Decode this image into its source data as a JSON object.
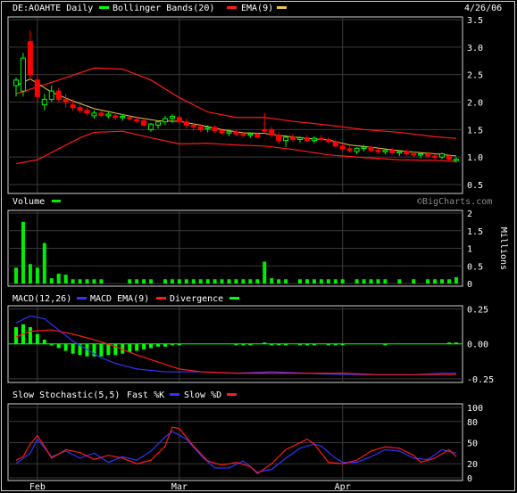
{
  "colors": {
    "background": "#000000",
    "frame": "#d0d0d0",
    "grid": "#3a3a3a",
    "text": "#ffffff",
    "up_candle": "#00ff00",
    "down_candle": "#ff0000",
    "bollinger": "#ff1a1a",
    "ema": "#e6c84a",
    "volume": "#00ee00",
    "macd": "#3333ff",
    "macd_ema": "#ff1a1a",
    "divergence": "#00ff00",
    "fast_k": "#3333ff",
    "slow_d": "#ff1a1a",
    "watermark": "#8a8a8a"
  },
  "chart_data": [
    {
      "type": "candlestick",
      "title": "DE:AOAHTE Daily",
      "date": "4/26/06",
      "legend": [
        {
          "name": "Bollinger Bands(20)",
          "color": "#00ff00"
        },
        {
          "name": "EMA(9)",
          "color": "#e6c84a"
        }
      ],
      "yticks": [
        "3.5",
        "3.0",
        "2.5",
        "2.0",
        "1.5",
        "1.0",
        "0.5"
      ],
      "ylim": [
        0.5,
        3.5
      ],
      "candles": [
        [
          2.4,
          2.45,
          2.1,
          2.3,
          "up"
        ],
        [
          2.2,
          2.9,
          2.1,
          2.8,
          "up"
        ],
        [
          3.1,
          3.3,
          2.4,
          2.5,
          "down"
        ],
        [
          2.4,
          2.5,
          2.0,
          2.1,
          "down"
        ],
        [
          1.95,
          2.15,
          1.85,
          2.05,
          "up"
        ],
        [
          2.05,
          2.3,
          2.0,
          2.2,
          "up"
        ],
        [
          2.2,
          2.25,
          2.0,
          2.05,
          "down"
        ],
        [
          2.05,
          2.15,
          1.9,
          2.0,
          "down"
        ],
        [
          1.95,
          2.05,
          1.85,
          1.9,
          "down"
        ],
        [
          1.9,
          1.95,
          1.8,
          1.85,
          "down"
        ],
        [
          1.85,
          1.9,
          1.75,
          1.8,
          "down"
        ],
        [
          1.75,
          1.85,
          1.7,
          1.8,
          "up"
        ],
        [
          1.8,
          1.85,
          1.72,
          1.76,
          "down"
        ],
        [
          1.75,
          1.82,
          1.7,
          1.78,
          "up"
        ],
        [
          1.75,
          1.8,
          1.68,
          1.72,
          "down"
        ],
        [
          1.72,
          1.78,
          1.66,
          1.74,
          "up"
        ],
        [
          1.72,
          1.76,
          1.66,
          1.7,
          "down"
        ],
        [
          1.68,
          1.74,
          1.62,
          1.66,
          "down"
        ],
        [
          1.66,
          1.7,
          1.55,
          1.58,
          "down"
        ],
        [
          1.5,
          1.62,
          1.46,
          1.6,
          "up"
        ],
        [
          1.58,
          1.66,
          1.52,
          1.64,
          "up"
        ],
        [
          1.64,
          1.75,
          1.58,
          1.7,
          "up"
        ],
        [
          1.7,
          1.78,
          1.62,
          1.74,
          "up"
        ],
        [
          1.72,
          1.76,
          1.6,
          1.64,
          "down"
        ],
        [
          1.64,
          1.7,
          1.52,
          1.58,
          "down"
        ],
        [
          1.58,
          1.62,
          1.48,
          1.55,
          "down"
        ],
        [
          1.55,
          1.6,
          1.46,
          1.5,
          "down"
        ],
        [
          1.52,
          1.58,
          1.45,
          1.54,
          "up"
        ],
        [
          1.54,
          1.58,
          1.44,
          1.48,
          "down"
        ],
        [
          1.48,
          1.52,
          1.4,
          1.44,
          "down"
        ],
        [
          1.44,
          1.5,
          1.38,
          1.46,
          "up"
        ],
        [
          1.46,
          1.5,
          1.38,
          1.42,
          "down"
        ],
        [
          1.42,
          1.46,
          1.36,
          1.4,
          "down"
        ],
        [
          1.4,
          1.45,
          1.35,
          1.42,
          "up"
        ],
        [
          1.42,
          1.45,
          1.34,
          1.36,
          "down"
        ],
        [
          1.48,
          1.8,
          1.42,
          1.5,
          "down"
        ],
        [
          1.5,
          1.55,
          1.35,
          1.4,
          "down"
        ],
        [
          1.4,
          1.45,
          1.25,
          1.3,
          "down"
        ],
        [
          1.3,
          1.4,
          1.18,
          1.36,
          "up"
        ],
        [
          1.36,
          1.42,
          1.28,
          1.32,
          "down"
        ],
        [
          1.32,
          1.38,
          1.26,
          1.35,
          "up"
        ],
        [
          1.35,
          1.4,
          1.28,
          1.3,
          "down"
        ],
        [
          1.3,
          1.38,
          1.25,
          1.34,
          "up"
        ],
        [
          1.34,
          1.4,
          1.28,
          1.32,
          "down"
        ],
        [
          1.32,
          1.36,
          1.25,
          1.28,
          "down"
        ],
        [
          1.28,
          1.32,
          1.18,
          1.2,
          "down"
        ],
        [
          1.2,
          1.25,
          1.12,
          1.15,
          "down"
        ],
        [
          1.15,
          1.2,
          1.08,
          1.12,
          "down"
        ],
        [
          1.1,
          1.18,
          1.06,
          1.16,
          "up"
        ],
        [
          1.16,
          1.22,
          1.1,
          1.18,
          "up"
        ],
        [
          1.18,
          1.2,
          1.1,
          1.12,
          "down"
        ],
        [
          1.12,
          1.16,
          1.05,
          1.1,
          "down"
        ],
        [
          1.1,
          1.15,
          1.05,
          1.12,
          "up"
        ],
        [
          1.12,
          1.16,
          1.06,
          1.08,
          "down"
        ],
        [
          1.08,
          1.12,
          1.02,
          1.1,
          "up"
        ],
        [
          1.1,
          1.14,
          1.03,
          1.06,
          "down"
        ],
        [
          1.06,
          1.1,
          1.0,
          1.04,
          "down"
        ],
        [
          1.04,
          1.08,
          0.98,
          1.06,
          "up"
        ],
        [
          1.06,
          1.1,
          0.98,
          1.02,
          "down"
        ],
        [
          1.02,
          1.06,
          0.96,
          1.0,
          "down"
        ],
        [
          1.0,
          1.08,
          0.96,
          1.06,
          "up"
        ],
        [
          1.02,
          1.05,
          0.94,
          0.96,
          "down"
        ],
        [
          0.96,
          1.0,
          0.9,
          0.94,
          "up"
        ]
      ],
      "bollinger_upper": [
        [
          0,
          2.15
        ],
        [
          6,
          2.4
        ],
        [
          11,
          2.62
        ],
        [
          15,
          2.6
        ],
        [
          19,
          2.4
        ],
        [
          23,
          2.08
        ],
        [
          27,
          1.82
        ],
        [
          31,
          1.72
        ],
        [
          35,
          1.72
        ],
        [
          39,
          1.65
        ],
        [
          44,
          1.58
        ],
        [
          49,
          1.5
        ],
        [
          54,
          1.45
        ],
        [
          59,
          1.37
        ],
        [
          62,
          1.34
        ]
      ],
      "bollinger_lower": [
        [
          0,
          0.88
        ],
        [
          3,
          0.95
        ],
        [
          6,
          1.15
        ],
        [
          9,
          1.35
        ],
        [
          11,
          1.45
        ],
        [
          15,
          1.47
        ],
        [
          19,
          1.35
        ],
        [
          23,
          1.24
        ],
        [
          27,
          1.25
        ],
        [
          31,
          1.22
        ],
        [
          35,
          1.2
        ],
        [
          39,
          1.14
        ],
        [
          44,
          1.04
        ],
        [
          49,
          0.99
        ],
        [
          54,
          0.95
        ],
        [
          59,
          0.94
        ],
        [
          62,
          0.92
        ]
      ],
      "ema": [
        [
          0,
          2.3
        ],
        [
          2,
          2.42
        ],
        [
          5,
          2.18
        ],
        [
          8,
          2.02
        ],
        [
          11,
          1.88
        ],
        [
          14,
          1.8
        ],
        [
          17,
          1.72
        ],
        [
          20,
          1.66
        ],
        [
          23,
          1.65
        ],
        [
          26,
          1.58
        ],
        [
          29,
          1.5
        ],
        [
          32,
          1.44
        ],
        [
          35,
          1.43
        ],
        [
          38,
          1.38
        ],
        [
          41,
          1.34
        ],
        [
          44,
          1.31
        ],
        [
          47,
          1.22
        ],
        [
          50,
          1.18
        ],
        [
          53,
          1.13
        ],
        [
          56,
          1.09
        ],
        [
          59,
          1.06
        ],
        [
          62,
          1.02
        ]
      ]
    },
    {
      "type": "bar",
      "title": "Volume",
      "legend": [
        {
          "name": "Volume",
          "color": "#00ee00"
        }
      ],
      "units_label": "Millions",
      "yticks": [
        "2",
        "1.5",
        "1",
        "0.5",
        "0"
      ],
      "ylim": [
        0,
        2
      ],
      "values": [
        0.45,
        1.75,
        0.55,
        0.45,
        1.15,
        0.15,
        0.28,
        0.25,
        0.12,
        0.12,
        0.12,
        0.12,
        0.12,
        0,
        0,
        0,
        0.12,
        0.12,
        0.12,
        0.12,
        0,
        0.12,
        0.12,
        0.12,
        0.12,
        0.12,
        0.12,
        0.12,
        0.12,
        0.12,
        0.12,
        0.12,
        0.12,
        0.12,
        0.12,
        0.62,
        0.15,
        0.12,
        0.12,
        0,
        0.12,
        0.12,
        0.12,
        0.12,
        0.12,
        0.12,
        0.12,
        0,
        0.12,
        0.12,
        0.12,
        0.12,
        0.12,
        0,
        0.12,
        0,
        0.12,
        0,
        0.12,
        0.12,
        0.12,
        0.12,
        0.18
      ]
    },
    {
      "type": "line",
      "title": "MACD(12,26)",
      "legend": [
        {
          "name": "MACD(12,26)",
          "color": "#ffffff"
        },
        {
          "name": "MACD EMA(9)",
          "color": "#3333ff"
        },
        {
          "name": "Divergence",
          "color": "#00ff00"
        }
      ],
      "yticks": [
        "0.25",
        "0.00",
        "-0.25"
      ],
      "ylim": [
        -0.27,
        0.26
      ],
      "macd": [
        [
          0,
          0.15
        ],
        [
          2,
          0.2
        ],
        [
          4,
          0.18
        ],
        [
          6,
          0.1
        ],
        [
          8,
          0.02
        ],
        [
          10,
          -0.04
        ],
        [
          12,
          -0.1
        ],
        [
          14,
          -0.14
        ],
        [
          17,
          -0.18
        ],
        [
          21,
          -0.2
        ],
        [
          26,
          -0.2
        ],
        [
          31,
          -0.21
        ],
        [
          36,
          -0.2
        ],
        [
          41,
          -0.21
        ],
        [
          46,
          -0.22
        ],
        [
          51,
          -0.22
        ],
        [
          56,
          -0.22
        ],
        [
          60,
          -0.21
        ],
        [
          62,
          -0.21
        ]
      ],
      "macd_ema": [
        [
          0,
          0.05
        ],
        [
          2,
          0.09
        ],
        [
          5,
          0.1
        ],
        [
          8,
          0.07
        ],
        [
          11,
          0.03
        ],
        [
          14,
          -0.02
        ],
        [
          17,
          -0.08
        ],
        [
          20,
          -0.13
        ],
        [
          23,
          -0.18
        ],
        [
          26,
          -0.2
        ],
        [
          31,
          -0.21
        ],
        [
          36,
          -0.21
        ],
        [
          41,
          -0.21
        ],
        [
          46,
          -0.21
        ],
        [
          51,
          -0.22
        ],
        [
          56,
          -0.22
        ],
        [
          62,
          -0.22
        ]
      ],
      "divergence": [
        0.12,
        0.14,
        0.12,
        0.07,
        0.03,
        -0.01,
        -0.03,
        -0.05,
        -0.07,
        -0.08,
        -0.09,
        -0.09,
        -0.09,
        -0.08,
        -0.08,
        -0.07,
        -0.06,
        -0.05,
        -0.04,
        -0.03,
        -0.02,
        -0.02,
        -0.01,
        -0.01,
        0,
        0,
        0,
        0,
        0,
        0,
        0,
        -0.01,
        -0.01,
        -0.01,
        0,
        0.01,
        -0.01,
        -0.01,
        -0.01,
        0,
        -0.01,
        -0.01,
        -0.01,
        0,
        -0.01,
        -0.01,
        -0.01,
        0,
        0,
        0,
        0,
        0,
        -0.01,
        0,
        0,
        0,
        0,
        0,
        0,
        0,
        0,
        0.01,
        0.01
      ]
    },
    {
      "type": "line",
      "title": "Slow Stochastic(5,5)",
      "legend": [
        {
          "name": "Fast %K",
          "color": "#3333ff"
        },
        {
          "name": "Slow %D",
          "color": "#ff1a1a"
        }
      ],
      "yticks": [
        "100",
        "80",
        "50",
        "20",
        "0"
      ],
      "ylim": [
        0,
        100
      ],
      "xlabels": [
        {
          "label": "Feb",
          "index": 3
        },
        {
          "label": "Mar",
          "index": 23
        },
        {
          "label": "Apr",
          "index": 46
        }
      ],
      "fast_k": [
        [
          0,
          20
        ],
        [
          2,
          35
        ],
        [
          3,
          55
        ],
        [
          5,
          30
        ],
        [
          7,
          38
        ],
        [
          9,
          28
        ],
        [
          11,
          35
        ],
        [
          13,
          22
        ],
        [
          15,
          30
        ],
        [
          17,
          25
        ],
        [
          19,
          38
        ],
        [
          21,
          58
        ],
        [
          22,
          66
        ],
        [
          24,
          55
        ],
        [
          26,
          32
        ],
        [
          28,
          14
        ],
        [
          30,
          14
        ],
        [
          32,
          24
        ],
        [
          34,
          8
        ],
        [
          36,
          12
        ],
        [
          38,
          28
        ],
        [
          40,
          42
        ],
        [
          42,
          48
        ],
        [
          43,
          45
        ],
        [
          45,
          28
        ],
        [
          46,
          22
        ],
        [
          48,
          22
        ],
        [
          50,
          30
        ],
        [
          52,
          40
        ],
        [
          54,
          38
        ],
        [
          56,
          28
        ],
        [
          58,
          26
        ],
        [
          60,
          40
        ],
        [
          62,
          35
        ]
      ],
      "slow_d": [
        [
          0,
          25
        ],
        [
          1,
          30
        ],
        [
          2,
          48
        ],
        [
          3,
          60
        ],
        [
          4,
          45
        ],
        [
          5,
          28
        ],
        [
          7,
          40
        ],
        [
          9,
          36
        ],
        [
          11,
          26
        ],
        [
          13,
          32
        ],
        [
          15,
          28
        ],
        [
          17,
          20
        ],
        [
          19,
          25
        ],
        [
          21,
          45
        ],
        [
          22,
          72
        ],
        [
          23,
          70
        ],
        [
          25,
          45
        ],
        [
          27,
          24
        ],
        [
          29,
          18
        ],
        [
          31,
          22
        ],
        [
          33,
          16
        ],
        [
          34,
          6
        ],
        [
          36,
          20
        ],
        [
          38,
          40
        ],
        [
          40,
          50
        ],
        [
          41,
          55
        ],
        [
          42,
          48
        ],
        [
          44,
          22
        ],
        [
          46,
          20
        ],
        [
          48,
          25
        ],
        [
          50,
          38
        ],
        [
          52,
          44
        ],
        [
          54,
          42
        ],
        [
          56,
          32
        ],
        [
          57,
          22
        ],
        [
          59,
          28
        ],
        [
          61,
          40
        ],
        [
          62,
          30
        ]
      ]
    }
  ],
  "watermark": "©BigCharts.com"
}
